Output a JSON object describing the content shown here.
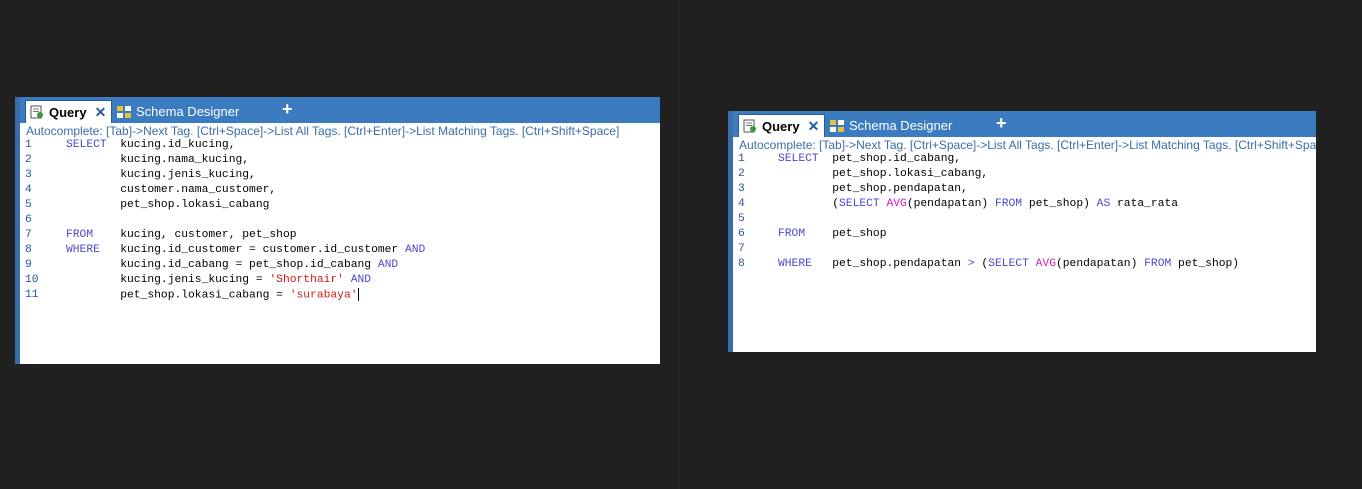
{
  "left": {
    "tabs": {
      "query_label": "Query",
      "close_label": "✕",
      "schema_label": "Schema Designer",
      "add_label": "+"
    },
    "autocomplete": "Autocomplete: [Tab]->Next Tag. [Ctrl+Space]->List All Tags. [Ctrl+Enter]->List Matching Tags. [Ctrl+Shift+Space]",
    "lines": [
      {
        "n": "1",
        "tokens": [
          {
            "t": "kw",
            "v": "SELECT"
          },
          {
            "t": "p",
            "v": "  kucing.id_kucing,"
          }
        ]
      },
      {
        "n": "2",
        "tokens": [
          {
            "t": "p",
            "v": "        kucing.nama_kucing,"
          }
        ]
      },
      {
        "n": "3",
        "tokens": [
          {
            "t": "p",
            "v": "        kucing.jenis_kucing,"
          }
        ]
      },
      {
        "n": "4",
        "tokens": [
          {
            "t": "p",
            "v": "        customer.nama_customer,"
          }
        ]
      },
      {
        "n": "5",
        "tokens": [
          {
            "t": "p",
            "v": "        pet_shop.lokasi_cabang"
          }
        ]
      },
      {
        "n": "6",
        "tokens": []
      },
      {
        "n": "7",
        "tokens": [
          {
            "t": "kw",
            "v": "FROM"
          },
          {
            "t": "p",
            "v": "    kucing, customer, pet_shop"
          }
        ]
      },
      {
        "n": "8",
        "tokens": [
          {
            "t": "kw",
            "v": "WHERE"
          },
          {
            "t": "p",
            "v": "   kucing.id_customer = customer.id_customer "
          },
          {
            "t": "kw",
            "v": "AND"
          }
        ]
      },
      {
        "n": "9",
        "tokens": [
          {
            "t": "p",
            "v": "        kucing.id_cabang = pet_shop.id_cabang "
          },
          {
            "t": "kw",
            "v": "AND"
          }
        ]
      },
      {
        "n": "10",
        "tokens": [
          {
            "t": "p",
            "v": "        kucing.jenis_kucing = "
          },
          {
            "t": "str",
            "v": "'Shorthair'"
          },
          {
            "t": "p",
            "v": " "
          },
          {
            "t": "kw",
            "v": "AND"
          }
        ]
      },
      {
        "n": "11",
        "tokens": [
          {
            "t": "p",
            "v": "        pet_shop.lokasi_cabang = "
          },
          {
            "t": "str",
            "v": "'surabaya'"
          },
          {
            "t": "caret",
            "v": ""
          }
        ]
      }
    ]
  },
  "right": {
    "tabs": {
      "query_label": "Query",
      "close_label": "✕",
      "schema_label": "Schema Designer",
      "add_label": "+"
    },
    "autocomplete": "Autocomplete: [Tab]->Next Tag. [Ctrl+Space]->List All Tags. [Ctrl+Enter]->List Matching Tags. [Ctrl+Shift+Space]",
    "lines": [
      {
        "n": "1",
        "tokens": [
          {
            "t": "kw",
            "v": "SELECT"
          },
          {
            "t": "p",
            "v": "  pet_shop.id_cabang,"
          }
        ]
      },
      {
        "n": "2",
        "tokens": [
          {
            "t": "p",
            "v": "        pet_shop.lokasi_cabang,"
          }
        ]
      },
      {
        "n": "3",
        "tokens": [
          {
            "t": "p",
            "v": "        pet_shop.pendapatan,"
          }
        ]
      },
      {
        "n": "4",
        "tokens": [
          {
            "t": "p",
            "v": "        ("
          },
          {
            "t": "kw",
            "v": "SELECT"
          },
          {
            "t": "p",
            "v": " "
          },
          {
            "t": "fn",
            "v": "AVG"
          },
          {
            "t": "p",
            "v": "(pendapatan) "
          },
          {
            "t": "kw",
            "v": "FROM"
          },
          {
            "t": "p",
            "v": " pet_shop) "
          },
          {
            "t": "kw",
            "v": "AS"
          },
          {
            "t": "p",
            "v": " rata_rata"
          }
        ]
      },
      {
        "n": "5",
        "tokens": []
      },
      {
        "n": "6",
        "tokens": [
          {
            "t": "kw",
            "v": "FROM"
          },
          {
            "t": "p",
            "v": "    pet_shop"
          }
        ]
      },
      {
        "n": "7",
        "tokens": []
      },
      {
        "n": "8",
        "tokens": [
          {
            "t": "kw",
            "v": "WHERE"
          },
          {
            "t": "p",
            "v": "   pet_shop.pendapatan "
          },
          {
            "t": "kw",
            "v": ">"
          },
          {
            "t": "p",
            "v": " ("
          },
          {
            "t": "kw",
            "v": "SELECT"
          },
          {
            "t": "p",
            "v": " "
          },
          {
            "t": "fn",
            "v": "AVG"
          },
          {
            "t": "p",
            "v": "(pendapatan) "
          },
          {
            "t": "kw",
            "v": "FROM"
          },
          {
            "t": "p",
            "v": " pet_shop)"
          }
        ]
      }
    ]
  },
  "colors": {
    "tabbar": "#3b7bbf",
    "keyword": "#4a4ad0",
    "function": "#d020c0",
    "string": "#d01818",
    "line_number": "#2a55a0",
    "background": "#202020"
  },
  "icons": {
    "query": "query-doc-icon",
    "schema": "schema-designer-icon"
  }
}
